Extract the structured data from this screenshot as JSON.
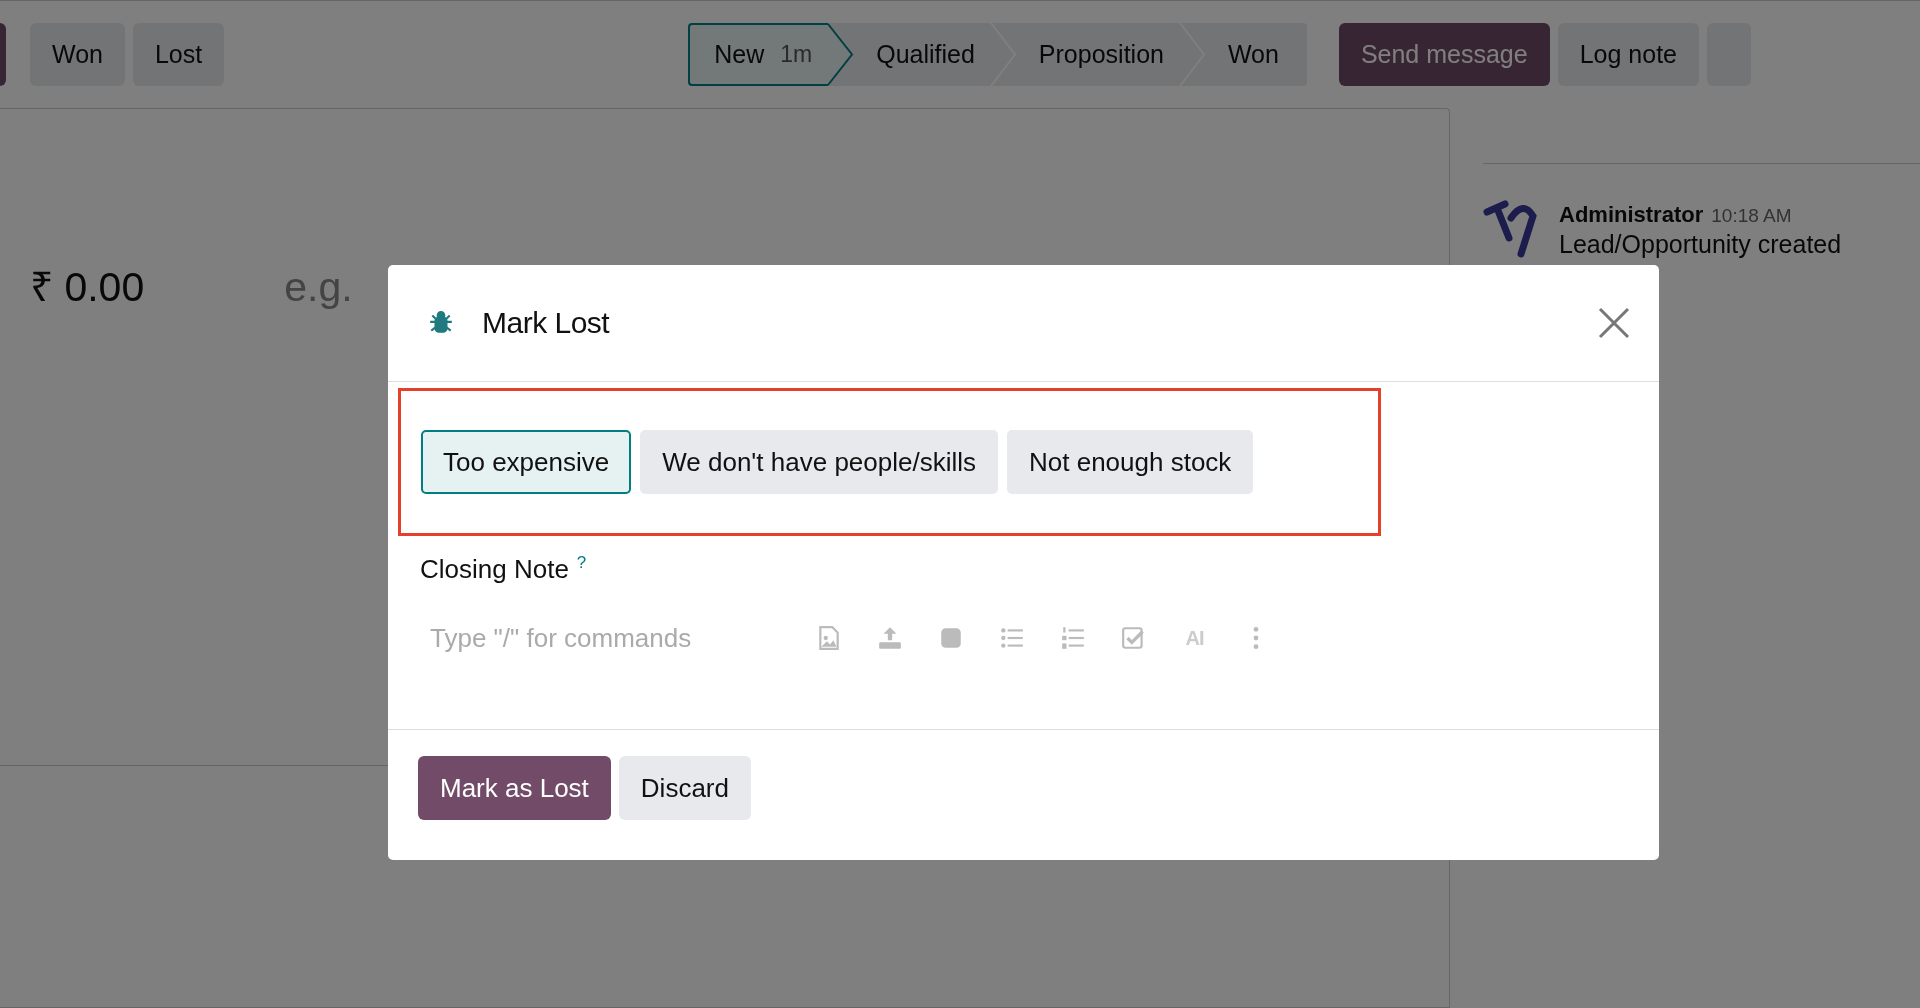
{
  "top_actions": [
    {
      "label": "Won"
    },
    {
      "label": "Lost"
    }
  ],
  "stages": [
    {
      "label": "New",
      "duration": "1m",
      "selected": true
    },
    {
      "label": "Qualified",
      "selected": false
    },
    {
      "label": "Proposition",
      "selected": false
    },
    {
      "label": "Won",
      "selected": false
    }
  ],
  "form": {
    "amount": "₹ 0.00",
    "placeholder": "e.g."
  },
  "chatter": {
    "buttons": [
      {
        "label": "Send message",
        "kind": "primary"
      },
      {
        "label": "Log note",
        "kind": "secondary"
      }
    ],
    "messages": [
      {
        "author": "Administrator",
        "time": "10:18 AM",
        "body": "Lead/Opportunity created"
      }
    ]
  },
  "dialog": {
    "title": "Mark Lost",
    "highlighted": true,
    "reasons": [
      {
        "label": "Too expensive",
        "selected": true
      },
      {
        "label": "We don't have people/skills",
        "selected": false
      },
      {
        "label": "Not enough stock",
        "selected": false
      }
    ],
    "note_label": "Closing Note",
    "note_help": "?",
    "note_placeholder": "Type \"/\" for commands",
    "toolbar": [
      {
        "kind": "image"
      },
      {
        "kind": "upload"
      },
      {
        "kind": "square"
      },
      {
        "kind": "bullets"
      },
      {
        "kind": "numbers"
      },
      {
        "kind": "checklist"
      },
      {
        "kind": "ai",
        "label": "AI"
      },
      {
        "kind": "more"
      }
    ],
    "buttons": [
      {
        "label": "Mark as Lost",
        "kind": "primary"
      },
      {
        "label": "Discard",
        "kind": "secondary"
      }
    ]
  }
}
